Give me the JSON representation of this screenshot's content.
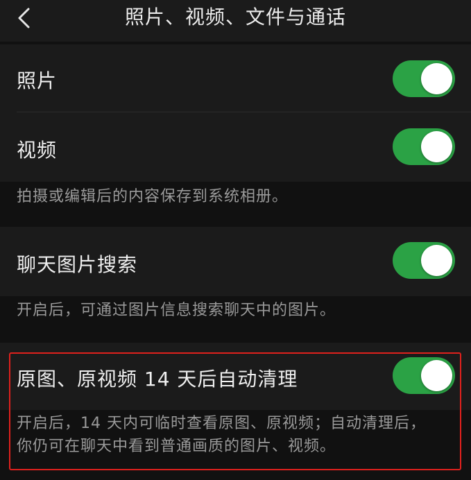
{
  "nav": {
    "title": "照片、视频、文件与通话",
    "back_icon": "chevron-left-icon"
  },
  "settings": {
    "photos": {
      "label": "照片",
      "enabled": true
    },
    "videos": {
      "label": "视频",
      "enabled": true
    },
    "save_note": "拍摄或编辑后的内容保存到系统相册。",
    "chat_image_search": {
      "label": "聊天图片搜索",
      "enabled": true
    },
    "search_note": "开启后，可通过图片信息搜索聊天中的图片。",
    "auto_clean": {
      "label": "原图、原视频 14 天后自动清理",
      "enabled": true
    },
    "auto_clean_note_line1": "开启后，14 天内可临时查看原图、原视频；自动清理后，",
    "auto_clean_note_line2": "你仍可在聊天中看到普通画质的图片、视频。"
  },
  "colors": {
    "background": "#111111",
    "cell": "#1b1b1b",
    "toggle_on": "#2ba245",
    "highlight": "#e0211d"
  }
}
